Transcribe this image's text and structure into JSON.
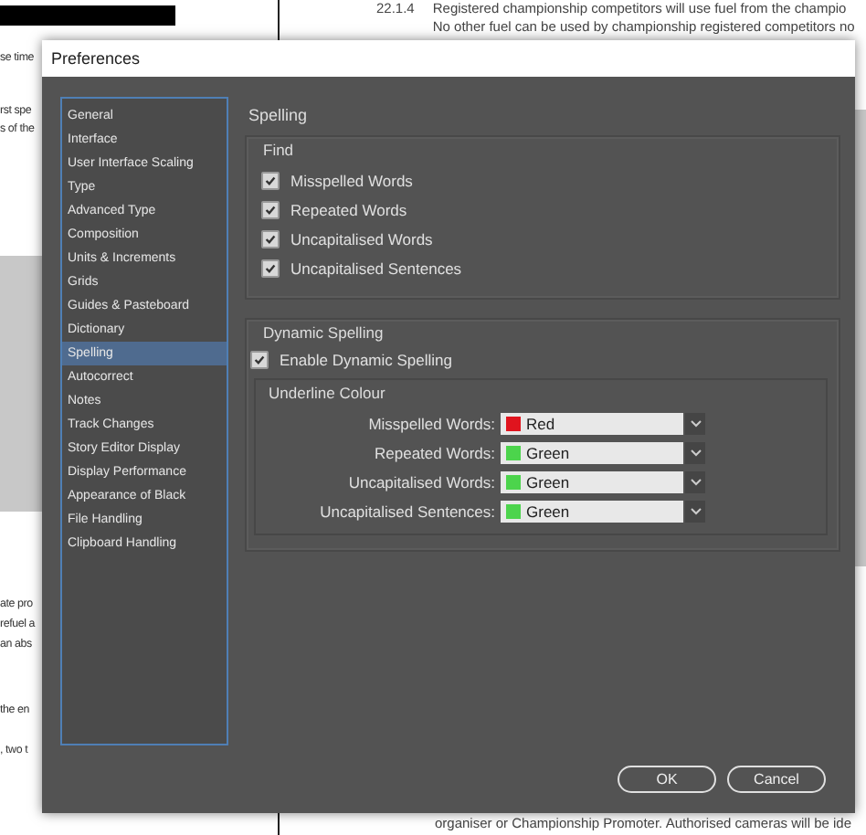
{
  "document": {
    "left_fragments": [
      "se time",
      "rst spe",
      "s of the",
      "ate pro",
      "refuel a",
      "an abs",
      "the en",
      ", two t"
    ],
    "clause_number": "22.1.4",
    "clause_lines": [
      "Registered championship competitors will use fuel from the champio",
      "No other fuel can be used by championship registered competitors no"
    ],
    "bottom_line": "organiser or Championship Promoter. Authorised cameras will be ide"
  },
  "window": {
    "title": "Preferences"
  },
  "sidebar": {
    "items": [
      {
        "label": "General",
        "selected": false
      },
      {
        "label": "Interface",
        "selected": false
      },
      {
        "label": "User Interface Scaling",
        "selected": false
      },
      {
        "label": "Type",
        "selected": false
      },
      {
        "label": "Advanced Type",
        "selected": false
      },
      {
        "label": "Composition",
        "selected": false
      },
      {
        "label": "Units & Increments",
        "selected": false
      },
      {
        "label": "Grids",
        "selected": false
      },
      {
        "label": "Guides & Pasteboard",
        "selected": false
      },
      {
        "label": "Dictionary",
        "selected": false
      },
      {
        "label": "Spelling",
        "selected": true
      },
      {
        "label": "Autocorrect",
        "selected": false
      },
      {
        "label": "Notes",
        "selected": false
      },
      {
        "label": "Track Changes",
        "selected": false
      },
      {
        "label": "Story Editor Display",
        "selected": false
      },
      {
        "label": "Display Performance",
        "selected": false
      },
      {
        "label": "Appearance of Black",
        "selected": false
      },
      {
        "label": "File Handling",
        "selected": false
      },
      {
        "label": "Clipboard Handling",
        "selected": false
      }
    ]
  },
  "panel": {
    "title": "Spelling",
    "find": {
      "label": "Find",
      "options": [
        {
          "label": "Misspelled Words",
          "checked": true
        },
        {
          "label": "Repeated Words",
          "checked": true
        },
        {
          "label": "Uncapitalised Words",
          "checked": true
        },
        {
          "label": "Uncapitalised Sentences",
          "checked": true
        }
      ]
    },
    "dynamic": {
      "label": "Dynamic Spelling",
      "enable": {
        "label": "Enable Dynamic Spelling",
        "checked": true
      },
      "underline_label": "Underline Colour",
      "rows": [
        {
          "label": "Misspelled Words:",
          "value": "Red",
          "color": "#e0141e"
        },
        {
          "label": "Repeated Words:",
          "value": "Green",
          "color": "#4cd44c"
        },
        {
          "label": "Uncapitalised Words:",
          "value": "Green",
          "color": "#4cd44c"
        },
        {
          "label": "Uncapitalised Sentences:",
          "value": "Green",
          "color": "#4cd44c"
        }
      ]
    }
  },
  "buttons": [
    "OK",
    "Cancel"
  ]
}
